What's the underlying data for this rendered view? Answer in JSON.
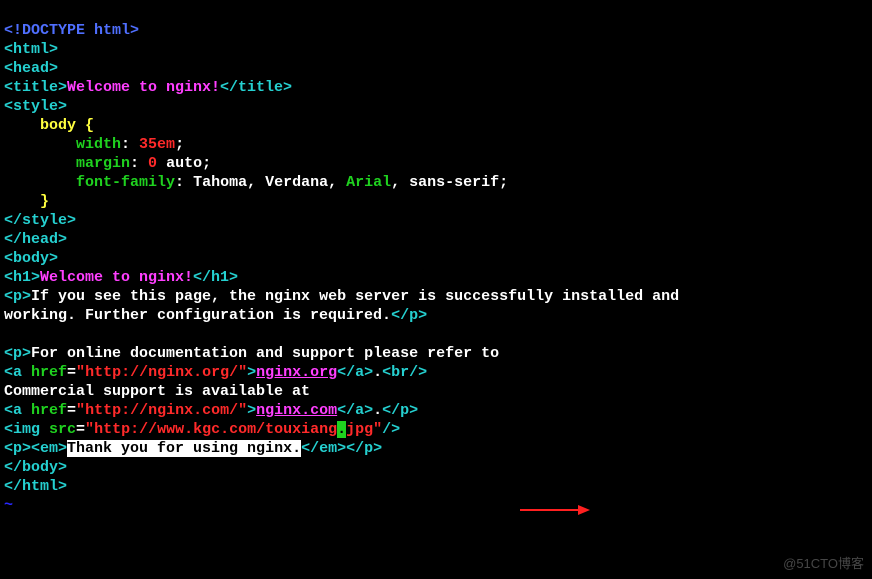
{
  "doctype": "<!DOCTYPE html>",
  "tags": {
    "html_o": "<html>",
    "html_c": "</html>",
    "head_o": "<head>",
    "head_c": "</head>",
    "title_o": "<title>",
    "title_c": "</title>",
    "style_o": "<style>",
    "style_c": "</style>",
    "body_o": "<body>",
    "body_c": "</body>",
    "h1_o": "<h1>",
    "h1_c": "</h1>",
    "p_o": "<p>",
    "p_c": "</p>",
    "a_o": "<a",
    "a_c": "</a>",
    "tag_end": ">",
    "br": "<br/>",
    "img_o": "<img",
    "selfclose": "/>",
    "em_o": "<em>",
    "em_c": "</em>"
  },
  "title_text": "Welcome to nginx!",
  "css": {
    "selector": "body",
    "brace_o": " {",
    "brace_c": "}",
    "width_k": "width",
    "width_v": "35em",
    "margin_k": "margin",
    "margin_v0": "0",
    "margin_v_tail": " auto",
    "ff_k": "font-family",
    "ff_v": " Tahoma, Verdana, ",
    "ff_arial": "Arial",
    "ff_tail": ", sans-serif"
  },
  "h1_text": "Welcome to nginx!",
  "para1": "If you see this page, the nginx web server is successfully installed and",
  "para1b": "working. Further configuration is required.",
  "para2": "For online documentation and support please refer to",
  "attr_href": " href",
  "eq_q": "=\"",
  "q": "\"",
  "link1_url": "http://nginx.org/",
  "link1_txt": "nginx.org",
  "para3": "Commercial support is available at",
  "link2_url": "http://nginx.com/",
  "link2_txt": "nginx.com",
  "dot": ".",
  "attr_src": " src",
  "img_url_pre": "http://www.kgc.com/touxiang",
  "img_url_cursor": ".",
  "img_url_post": "jpg",
  "thanks": "Thank you for using nginx.",
  "tilde": "~",
  "watermark": "@51CTO博客",
  "colon": ": ",
  "semi": ";"
}
